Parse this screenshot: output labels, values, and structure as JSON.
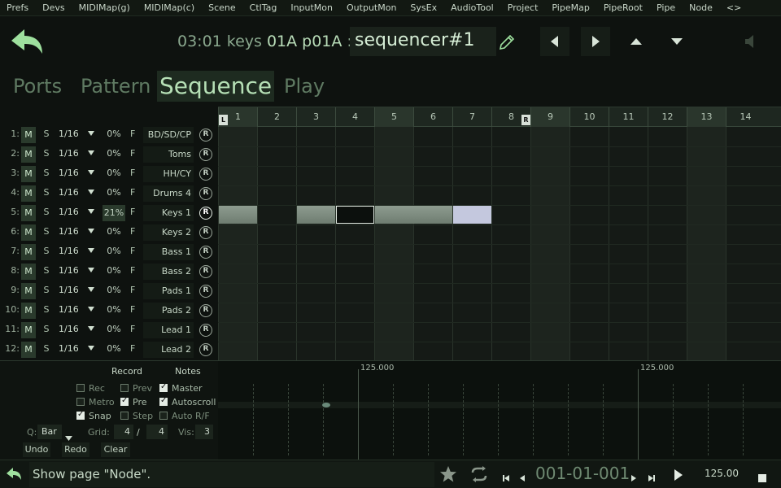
{
  "menu": [
    "Prefs",
    "Devs",
    "MIDIMap(g)",
    "MIDIMap(c)",
    "Scene",
    "CtlTag",
    "InputMon",
    "OutputMon",
    "SysEx",
    "AudioTool",
    "Project",
    "PipeMap",
    "PipeRoot",
    "Pipe",
    "Node",
    "<>"
  ],
  "header": {
    "time": "03:01 keys",
    "bank": "01A",
    "patch": "p01A",
    "sep": ":",
    "name": "sequencer#1"
  },
  "tabs": [
    "Ports",
    "Pattern",
    "Sequence",
    "Play"
  ],
  "active_tab": "Sequence",
  "tracks": [
    {
      "num": "1:",
      "m": "M",
      "s": "S",
      "res": "1/16",
      "pct": "0%",
      "f": "F",
      "name": "BD/SD/CP",
      "r": "R"
    },
    {
      "num": "2:",
      "m": "M",
      "s": "S",
      "res": "1/16",
      "pct": "0%",
      "f": "F",
      "name": "Toms",
      "r": "R"
    },
    {
      "num": "3:",
      "m": "M",
      "s": "S",
      "res": "1/16",
      "pct": "0%",
      "f": "F",
      "name": "HH/CY",
      "r": "R"
    },
    {
      "num": "4:",
      "m": "M",
      "s": "S",
      "res": "1/16",
      "pct": "0%",
      "f": "F",
      "name": "Drums 4",
      "r": "R"
    },
    {
      "num": "5:",
      "m": "M",
      "s": "S",
      "res": "1/16",
      "pct": "21%",
      "f": "F",
      "name": "Keys 1",
      "r": "R"
    },
    {
      "num": "6:",
      "m": "M",
      "s": "S",
      "res": "1/16",
      "pct": "0%",
      "f": "F",
      "name": "Keys 2",
      "r": "R"
    },
    {
      "num": "7:",
      "m": "M",
      "s": "S",
      "res": "1/16",
      "pct": "0%",
      "f": "F",
      "name": "Bass 1",
      "r": "R"
    },
    {
      "num": "8:",
      "m": "M",
      "s": "S",
      "res": "1/16",
      "pct": "0%",
      "f": "F",
      "name": "Bass 2",
      "r": "R"
    },
    {
      "num": "9:",
      "m": "M",
      "s": "S",
      "res": "1/16",
      "pct": "0%",
      "f": "F",
      "name": "Pads 1",
      "r": "R"
    },
    {
      "num": "10:",
      "m": "M",
      "s": "S",
      "res": "1/16",
      "pct": "0%",
      "f": "F",
      "name": "Pads 2",
      "r": "R"
    },
    {
      "num": "11:",
      "m": "M",
      "s": "S",
      "res": "1/16",
      "pct": "0%",
      "f": "F",
      "name": "Lead 1",
      "r": "R"
    },
    {
      "num": "12:",
      "m": "M",
      "s": "S",
      "res": "1/16",
      "pct": "0%",
      "f": "F",
      "name": "Lead 2",
      "r": "R"
    }
  ],
  "ruler": {
    "bars": [
      "1",
      "2",
      "3",
      "4",
      "5",
      "6",
      "7",
      "8",
      "9",
      "10",
      "11",
      "12",
      "13",
      "14"
    ],
    "loop_start": "L",
    "loop_end": "R"
  },
  "clips": [
    {
      "track": 5,
      "bars": [
        1
      ],
      "state": "gray"
    },
    {
      "track": 5,
      "bars": [
        3
      ],
      "state": "gray"
    },
    {
      "track": 5,
      "bars": [
        4
      ],
      "state": "selected"
    },
    {
      "track": 5,
      "bars": [
        5,
        6
      ],
      "state": "gray"
    },
    {
      "track": 5,
      "bars": [
        7
      ],
      "state": "highlight"
    }
  ],
  "controls": {
    "record_label": "Record",
    "notes_label": "Notes",
    "rec": "Rec",
    "metro": "Metro",
    "snap": "Snap",
    "prev": "Prev",
    "pre": "Pre",
    "step": "Step",
    "master": "Master",
    "autoscroll": "Autoscroll",
    "autorf": "Auto R/F",
    "checked": {
      "rec": false,
      "metro": false,
      "snap": true,
      "prev": false,
      "pre": true,
      "step": false,
      "master": true,
      "autoscroll": true,
      "autorf": false
    },
    "q_label": "Q:",
    "q_value": "Bar",
    "grid_label": "Grid:",
    "grid_num": "4",
    "grid_slash": "/",
    "grid_den": "4",
    "vis_label": "Vis:",
    "vis_value": "3",
    "undo": "Undo",
    "redo": "Redo",
    "clear": "Clear"
  },
  "automation": {
    "marker1": "125.000",
    "marker2": "125.000"
  },
  "status": {
    "text": "Show page \"Node\".",
    "position": "001-01-001",
    "tempo": "125.00"
  },
  "colors": {
    "accent": "#a6d8a6",
    "clip_gray": "#7e8c80",
    "clip_highlight": "#c4c8de",
    "background": "#0e120f"
  },
  "icons": {
    "back": "back-arrow-icon",
    "edit": "pencil-icon",
    "left": "triangle-left-icon",
    "right": "triangle-right-icon",
    "up": "triangle-up-icon",
    "down": "triangle-down-icon",
    "speaker": "speaker-icon",
    "star": "star-icon",
    "loop": "loop-icon",
    "play": "play-icon",
    "stop": "stop-icon"
  }
}
